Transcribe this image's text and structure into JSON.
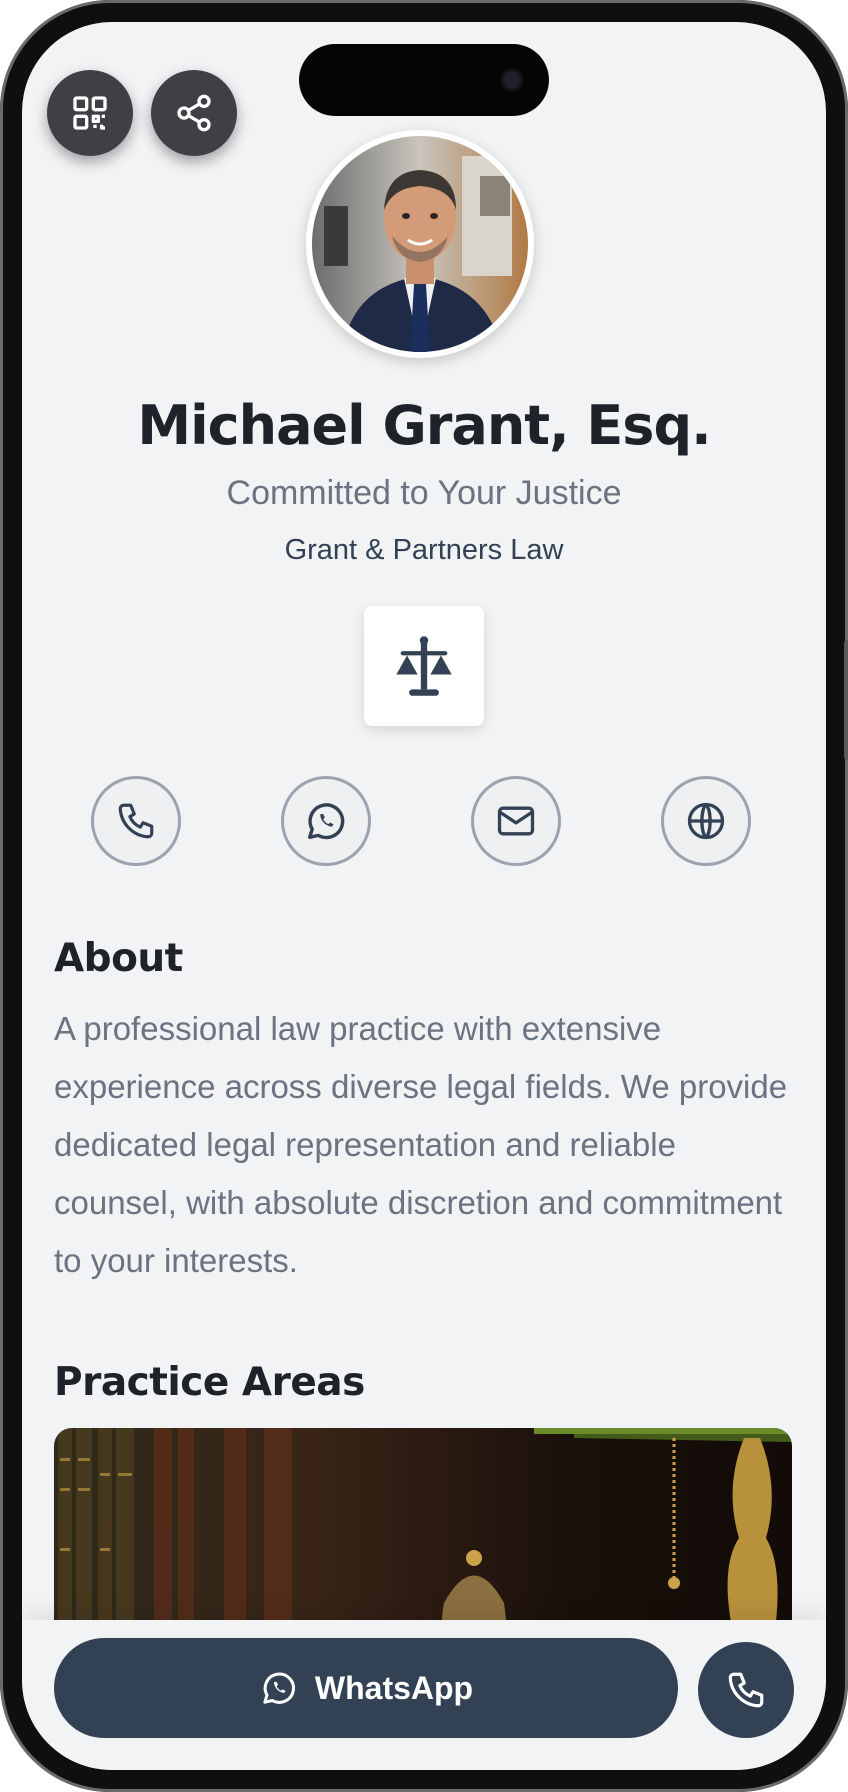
{
  "profile": {
    "name": "Michael Grant, Esq.",
    "tagline": "Committed to Your Justice",
    "firm": "Grant & Partners Law"
  },
  "icons": {
    "qr": "qr-code-icon",
    "share": "share-icon",
    "logo": "scales-of-justice-icon",
    "phone": "phone-icon",
    "whatsapp": "whatsapp-icon",
    "email": "mail-icon",
    "website": "globe-icon"
  },
  "about": {
    "heading": "About",
    "text": "A professional law practice with extensive experience across diverse legal fields. We provide dedicated legal representation and reliable counsel, with absolute discretion and commitment to your interests."
  },
  "practice": {
    "heading": "Practice Areas"
  },
  "cta": {
    "whatsapp_label": "WhatsApp"
  },
  "colors": {
    "primary": "#334155",
    "background": "#f1f3f5",
    "text_dark": "#1f2329",
    "text_muted": "#6b7280"
  }
}
